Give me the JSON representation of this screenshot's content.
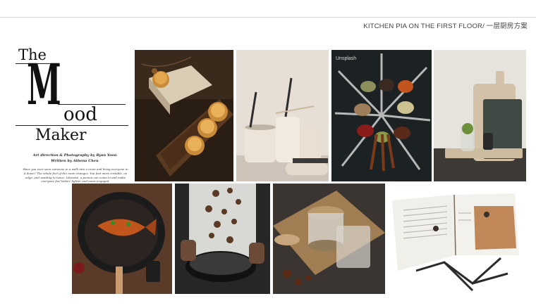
{
  "header": {
    "title": "KITCHEN PIA ON THE  FIRST FLOOR/ 一层厨房方案"
  },
  "magazine": {
    "the": "The",
    "m": "M",
    "ood": "ood",
    "maker": "Maker",
    "credit_line1": "Art direction & Photography by Ryan Yoon",
    "credit_line2": "Written by Athena Chen",
    "body_text": "Have you ever seen someone in a walk into a room and bring everyone in it down? The whole feel of the room changes. You feel more irritable, on edge, and wanting to leave. Likewise, a person can come in and make everyone feel better, lighter and more engaged."
  },
  "photos": {
    "mooncakes": "mooncakes-photo",
    "cookware_set": "cookware-set-photo",
    "spice_spoons": "spice-spoons-photo",
    "spoon_brand": "Unsplash",
    "cutting_boards": "cutting-boards-photo",
    "fish_wok": "fish-wok-photo",
    "chef_wok": "chef-wok-photo",
    "jars_tray": "jars-tray-photo",
    "cookbook_stand": "cookbook-stand-photo"
  }
}
